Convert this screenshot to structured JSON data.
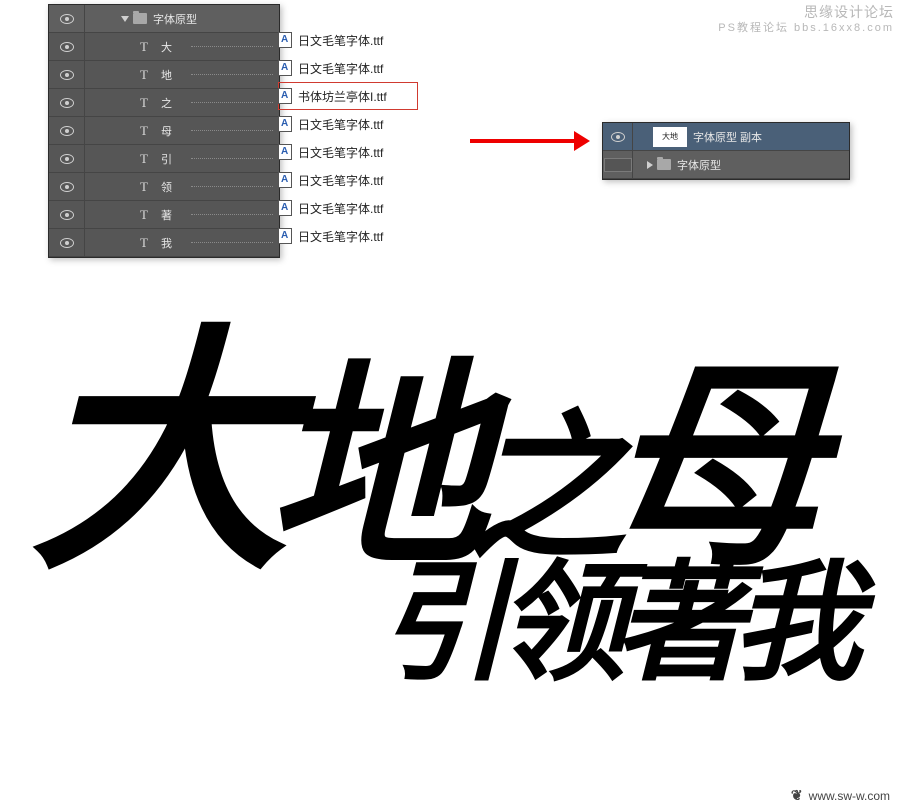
{
  "watermark": {
    "top_right_line1": "思缘设计论坛",
    "top_right_line2": "PS教程论坛 bbs.16xx8.com",
    "bottom_right_mark": "❦",
    "bottom_right_url": "www.sw-w.com"
  },
  "source_panel": {
    "group_name": "字体原型",
    "layers": [
      {
        "t": "T",
        "name": "大"
      },
      {
        "t": "T",
        "name": "地"
      },
      {
        "t": "T",
        "name": "之"
      },
      {
        "t": "T",
        "name": "母"
      },
      {
        "t": "T",
        "name": "引"
      },
      {
        "t": "T",
        "name": "领"
      },
      {
        "t": "T",
        "name": "著"
      },
      {
        "t": "T",
        "name": "我"
      }
    ]
  },
  "font_files": {
    "items": [
      {
        "name": "日文毛笔字体.ttf",
        "selected": false
      },
      {
        "name": "日文毛笔字体.ttf",
        "selected": false
      },
      {
        "name": "书体坊兰亭体I.ttf",
        "selected": true
      },
      {
        "name": "日文毛笔字体.ttf",
        "selected": false
      },
      {
        "name": "日文毛笔字体.ttf",
        "selected": false
      },
      {
        "name": "日文毛笔字体.ttf",
        "selected": false
      },
      {
        "name": "日文毛笔字体.ttf",
        "selected": false
      },
      {
        "name": "日文毛笔字体.ttf",
        "selected": false
      }
    ]
  },
  "result_panel": {
    "rows": [
      {
        "name": "字体原型 副本",
        "type": "smart",
        "selected": true
      },
      {
        "name": "字体原型",
        "type": "group",
        "selected": false
      }
    ]
  },
  "calligraphy": {
    "chars": {
      "c1": "大",
      "c2": "地",
      "c3": "之",
      "c4": "母",
      "c5": "引",
      "c6": "领",
      "c7": "著",
      "c8": "我"
    }
  }
}
